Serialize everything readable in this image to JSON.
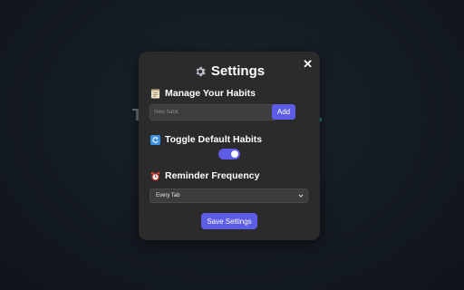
{
  "background": {
    "glyph": "T"
  },
  "modal": {
    "title": "Settings",
    "title_icon": "gear-icon",
    "close_label": "✕",
    "manage": {
      "label": "Manage Your Habits",
      "icon": "memo-icon",
      "input_placeholder": "New habit",
      "input_value": "",
      "add_label": "Add"
    },
    "toggle": {
      "label": "Toggle Default Habits",
      "icon": "refresh-icon",
      "state": "on"
    },
    "reminder": {
      "label": "Reminder Frequency",
      "icon": "alarm-clock-icon",
      "selected": "Every Tab"
    },
    "save_label": "Save Settings"
  },
  "colors": {
    "accent": "#5c5ce6",
    "modal_bg": "#2b2b2b",
    "input_bg": "#3d3d3d"
  }
}
